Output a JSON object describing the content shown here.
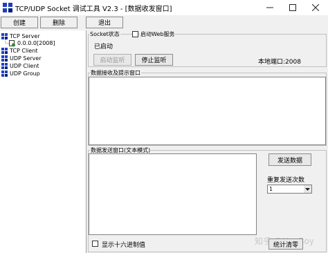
{
  "window": {
    "title": "TCP/UDP Socket 调试工具 V2.3 - [数据收发窗口]",
    "minimize_icon": "minimize-icon",
    "maximize_icon": "maximize-icon",
    "close_icon": "close-icon"
  },
  "toolbar": {
    "create_label": "创建",
    "delete_label": "删除",
    "exit_label": "退出"
  },
  "tree": {
    "items": [
      {
        "label": "TCP Server",
        "icon": "server-icon"
      },
      {
        "label": "0.0.0.0[2008]",
        "icon": "connection-icon"
      },
      {
        "label": "TCP Client",
        "icon": "network-icon"
      },
      {
        "label": "UDP Server",
        "icon": "network-icon"
      },
      {
        "label": "UDP Client",
        "icon": "network-icon"
      },
      {
        "label": "UDP Group",
        "icon": "network-icon"
      }
    ]
  },
  "socket": {
    "group_label": "Socket状态",
    "web_service_label": "启动Web服务",
    "status_text": "已启动",
    "start_listen_label": "启动监听",
    "stop_listen_label": "停止监听",
    "local_port_text": "本地端口:2008"
  },
  "receive": {
    "group_label": "数据接收及提示窗口",
    "content": ""
  },
  "send": {
    "group_label": "数据发送窗口(文本模式)",
    "content": "",
    "send_button_label": "发送数据",
    "repeat_label": "重复发送次数",
    "repeat_value": "1",
    "hex_label": "显示十六进制值",
    "clear_stats_label": "统计清零"
  },
  "watermark": "知乎 @HayBoy",
  "colors": {
    "icon_blue": "#1f3fbf",
    "icon_dark": "#0a1f7a",
    "titlebar": "#ffffff",
    "panel": "#f0f0f0"
  }
}
